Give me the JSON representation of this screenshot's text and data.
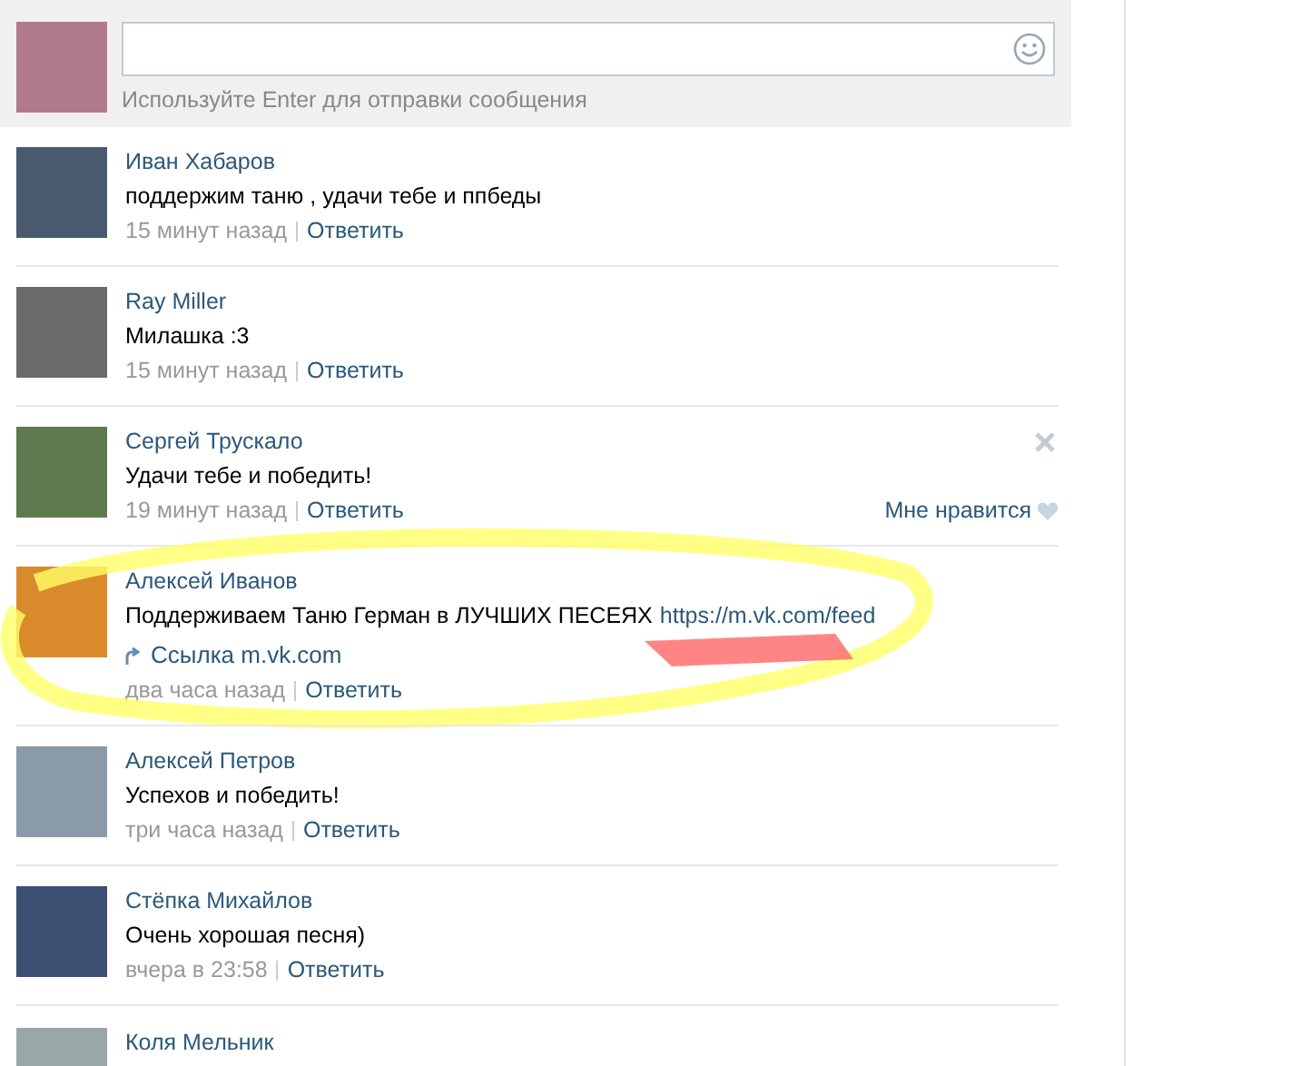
{
  "composer": {
    "hint": "Используйте Enter для отправки сообщения"
  },
  "comments": [
    {
      "kind": "plain",
      "author": "Иван Хабаров",
      "text": "поддержим таню , удачи тебе и ппбеды",
      "time": "15 минут назад",
      "reply": "Ответить"
    },
    {
      "kind": "plain",
      "author": "Ray Miller",
      "text": "Милашка :3",
      "time": "15 минут назад",
      "reply": "Ответить"
    },
    {
      "kind": "plain",
      "author": "Сергей Трускало",
      "text": "Удачи тебе и победить!",
      "time": "19 минут назад",
      "reply": "Ответить",
      "like": "Мне нравится",
      "deletable": true
    },
    {
      "kind": "link",
      "author": "Алексей Иванов",
      "text": "Поддерживаем Таню Герман в ЛУЧШИХ ПЕСЕЯХ",
      "url": "https://m.vk.com/feed",
      "attachment": "Ссылка m.vk.com",
      "time": "два часа назад",
      "reply": "Ответить",
      "highlighted": true
    },
    {
      "kind": "plain",
      "author": "Алексей Петров",
      "text": "Успехов и победить!",
      "time": "три часа назад",
      "reply": "Ответить"
    },
    {
      "kind": "plain",
      "author": "Стёпка Михайлов",
      "text": "Очень хорошая песня)",
      "time": "вчера в 23:58",
      "reply": "Ответить"
    },
    {
      "kind": "cut",
      "author": "Коля Мельник"
    }
  ]
}
